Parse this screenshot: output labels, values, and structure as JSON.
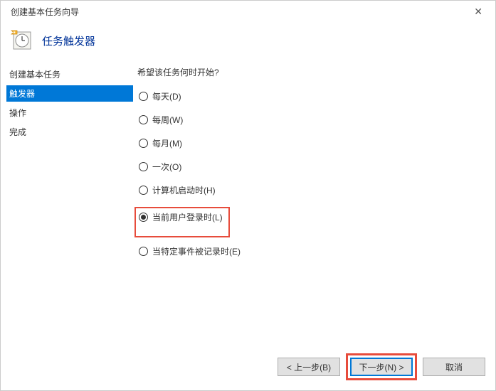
{
  "window": {
    "title": "创建基本任务向导"
  },
  "header": {
    "title": "任务触发器"
  },
  "sidebar": {
    "items": [
      {
        "label": "创建基本任务",
        "active": false
      },
      {
        "label": "触发器",
        "active": true
      },
      {
        "label": "操作",
        "active": false
      },
      {
        "label": "完成",
        "active": false
      }
    ]
  },
  "main": {
    "question": "希望该任务何时开始?",
    "options": [
      {
        "label": "每天(D)",
        "checked": false,
        "highlight": false
      },
      {
        "label": "每周(W)",
        "checked": false,
        "highlight": false
      },
      {
        "label": "每月(M)",
        "checked": false,
        "highlight": false
      },
      {
        "label": "一次(O)",
        "checked": false,
        "highlight": false
      },
      {
        "label": "计算机启动时(H)",
        "checked": false,
        "highlight": false
      },
      {
        "label": "当前用户登录时(L)",
        "checked": true,
        "highlight": true
      },
      {
        "label": "当特定事件被记录时(E)",
        "checked": false,
        "highlight": false
      }
    ]
  },
  "buttons": {
    "back": "< 上一步(B)",
    "next": "下一步(N) >",
    "cancel": "取消"
  }
}
